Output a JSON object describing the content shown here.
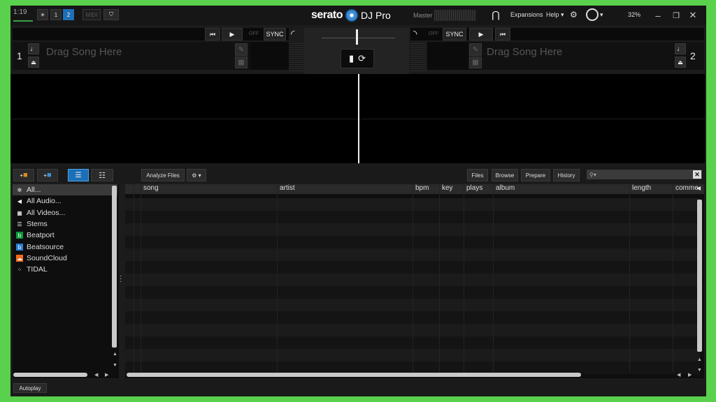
{
  "topbar": {
    "time": "1:19",
    "deck_buttons": [
      "1",
      "2"
    ],
    "midi_label": "MIDI",
    "brand": "serato",
    "product": "DJ Pro",
    "master_label": "Master",
    "expansions_label": "Expansions",
    "help_label": "Help",
    "cpu_percent": "32%"
  },
  "deck_left": {
    "number": "1",
    "placeholder": "Drag Song Here",
    "sync_label": "SYNC",
    "off_label": "OFF"
  },
  "deck_right": {
    "number": "2",
    "placeholder": "Drag Song Here",
    "sync_label": "SYNC",
    "off_label": "OFF"
  },
  "library_toolbar": {
    "analyze_label": "Analyze Files",
    "files_label": "Files",
    "browse_label": "Browse",
    "prepare_label": "Prepare",
    "history_label": "History",
    "search_placeholder": ""
  },
  "sidebar": {
    "items": [
      {
        "label": "All...",
        "icon": "sparkle-icon"
      },
      {
        "label": "All Audio...",
        "icon": "speaker-icon"
      },
      {
        "label": "All Videos...",
        "icon": "film-icon"
      },
      {
        "label": "Stems",
        "icon": "stems-icon"
      },
      {
        "label": "Beatport",
        "icon": "beatport-icon"
      },
      {
        "label": "Beatsource",
        "icon": "beatsource-icon"
      },
      {
        "label": "SoundCloud",
        "icon": "soundcloud-icon"
      },
      {
        "label": "TIDAL",
        "icon": "tidal-icon"
      }
    ]
  },
  "table": {
    "columns": [
      "song",
      "artist",
      "bpm",
      "key",
      "plays",
      "album",
      "length",
      "comme"
    ]
  },
  "footer": {
    "autoplay_label": "Autoplay"
  },
  "colors": {
    "accent": "#1d6fb6",
    "frame": "#5ad14c"
  }
}
